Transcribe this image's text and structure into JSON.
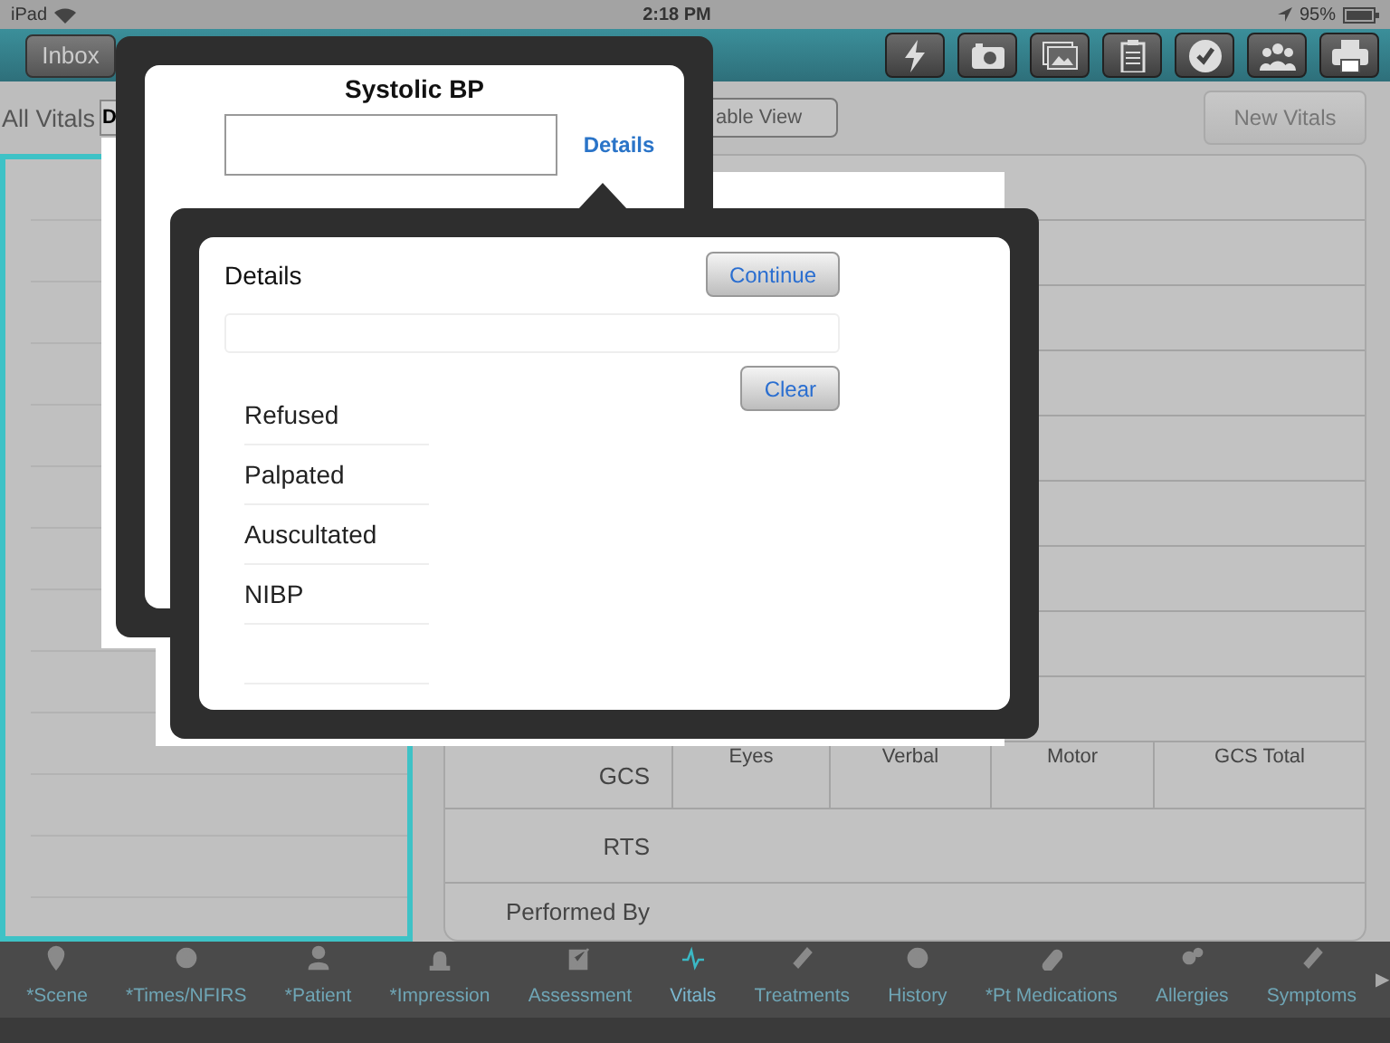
{
  "status_bar": {
    "device": "iPad",
    "time": "2:18 PM",
    "battery": "95%"
  },
  "toolbar": {
    "inbox_button": "Inbox"
  },
  "subbar": {
    "title": "All Vitals",
    "view_button": "D",
    "table_view_button": "able View",
    "new_vitals_button": "New Vitals"
  },
  "table": {
    "rows": [
      {
        "label": "GCS",
        "columns": [
          "Eyes",
          "Verbal",
          "Motor",
          "GCS Total"
        ]
      },
      {
        "label": "RTS"
      },
      {
        "label": "Performed By"
      }
    ]
  },
  "value_popover": {
    "title": "Systolic BP",
    "details_link": "Details"
  },
  "details_popover": {
    "title": "Details",
    "continue_button": "Continue",
    "clear_button": "Clear",
    "options": [
      "Refused",
      "Palpated",
      "Auscultated",
      "NIBP"
    ]
  },
  "tabs": [
    {
      "label": "*Scene",
      "selected": false
    },
    {
      "label": "*Times/NFIRS",
      "selected": false
    },
    {
      "label": "*Patient",
      "selected": false
    },
    {
      "label": "*Impression",
      "selected": false
    },
    {
      "label": "Assessment",
      "selected": false
    },
    {
      "label": "Vitals",
      "selected": true
    },
    {
      "label": "Treatments",
      "selected": false
    },
    {
      "label": "History",
      "selected": false
    },
    {
      "label": "*Pt Medications",
      "selected": false
    },
    {
      "label": "Allergies",
      "selected": false
    },
    {
      "label": "Symptoms",
      "selected": false
    }
  ],
  "more_arrow": "▶"
}
